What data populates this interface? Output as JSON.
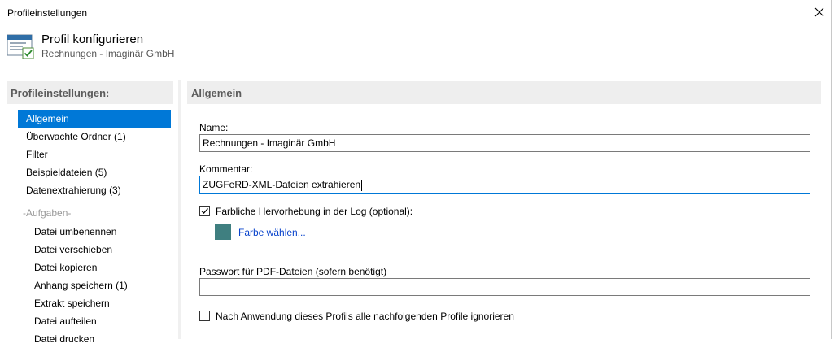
{
  "window": {
    "title": "Profileinstellungen",
    "close_icon": "close-icon"
  },
  "header": {
    "title": "Profil konfigurieren",
    "subtitle": "Rechnungen - Imaginär GmbH",
    "icon": "profile-config-icon"
  },
  "sidebar": {
    "header": "Profileinstellungen:",
    "items": [
      {
        "label": "Allgemein",
        "selected": true
      },
      {
        "label": "Überwachte Ordner (1)"
      },
      {
        "label": "Filter"
      },
      {
        "label": "Beispieldateien (5)"
      },
      {
        "label": "Datenextrahierung (3)"
      }
    ],
    "group_label": "-Aufgaben-",
    "tasks": [
      {
        "label": "Datei umbenennen"
      },
      {
        "label": "Datei verschieben"
      },
      {
        "label": "Datei kopieren"
      },
      {
        "label": "Anhang speichern (1)"
      },
      {
        "label": "Extrakt speichern"
      },
      {
        "label": "Datei aufteilen"
      },
      {
        "label": "Datei drucken"
      }
    ]
  },
  "main": {
    "section_title": "Allgemein",
    "name_label": "Name:",
    "name_value": "Rechnungen - Imaginär GmbH",
    "comment_label": "Kommentar:",
    "comment_value": "ZUGFeRD-XML-Dateien extrahieren",
    "highlight_label": "Farbliche Hervorhebung in der Log (optional):",
    "highlight_checked": true,
    "highlight_color": "#3f7f80",
    "choose_color_link": "Farbe wählen...",
    "password_label": "Passwort für PDF-Dateien (sofern benötigt)",
    "password_value": "",
    "ignore_label": "Nach Anwendung dieses Profils alle nachfolgenden Profile ignorieren",
    "ignore_checked": false
  },
  "colors": {
    "accent": "#0078d7",
    "link": "#0a44cc",
    "section_bg": "#eeeeee"
  }
}
